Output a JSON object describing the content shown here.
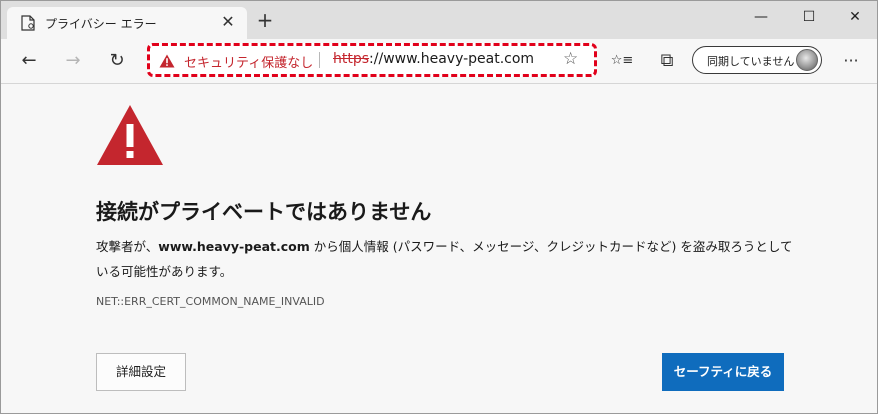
{
  "tab": {
    "title": "プライバシー エラー",
    "close_glyph": "✕",
    "new_tab_glyph": "+"
  },
  "window": {
    "minimize": "—",
    "maximize": "☐",
    "close": "✕"
  },
  "toolbar": {
    "back_glyph": "←",
    "forward_glyph": "→",
    "refresh_glyph": "↻",
    "address": {
      "security_warning": "セキュリティ保護なし",
      "url_scheme": "https",
      "url_rest": "://www.heavy-peat.com",
      "favorite_glyph": "☆"
    },
    "favorites_glyph": "☆≡",
    "collections_glyph": "⧉",
    "sync_label": "同期していません",
    "menu_glyph": "···"
  },
  "page": {
    "heading": "接続がプライベートではありません",
    "desc_before": "攻撃者が、",
    "desc_domain": "www.heavy-peat.com",
    "desc_after": " から個人情報 (パスワード、メッセージ、クレジットカードなど) を盗み取ろうとしている可能性があります。",
    "error_code": "NET::ERR_CERT_COMMON_NAME_INVALID",
    "advanced_button": "詳細設定",
    "back_button": "セーフティに戻る"
  },
  "colors": {
    "warning_red": "#c4262e",
    "highlight_border": "#e1001a",
    "primary_blue": "#0f6cbd"
  }
}
